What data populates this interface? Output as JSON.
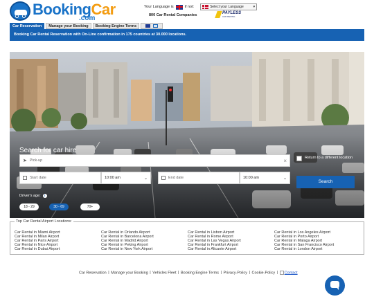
{
  "header": {
    "brand_part1": "Booking",
    "brand_part2": "Car",
    "brand_tld": ".com",
    "language_prompt": "Your Language is",
    "language_if_not": "if not:",
    "language_select": "Select your Language",
    "companies": "800 Car Rental Companies",
    "partner_logo": "PAYLESS",
    "partner_logo_sub": "CAR RENTAL"
  },
  "tabs": [
    {
      "label": "Car Reservation",
      "active": true
    },
    {
      "label": "Manage your Booking",
      "active": false
    },
    {
      "label": "Booking Engine Terms",
      "active": false
    }
  ],
  "banner": "Booking Car Rental Reservation with On-Line confirmation in 175 countries at 30.000 locations.",
  "search": {
    "title": "Search for car hire",
    "pickup_placeholder": "Pick-up",
    "start_date_placeholder": "Start date",
    "start_time": "10:00 am",
    "end_date_placeholder": "End date",
    "end_time": "10:00 am",
    "return_label": "Return to a different location",
    "button": "Search",
    "age_label": "Driver's age:",
    "age_options": [
      "18 - 29",
      "30 - 69",
      "70+"
    ],
    "age_selected": "30 - 69"
  },
  "locations": {
    "legend": "Top Car Rental Airport Locations:",
    "columns": [
      [
        "Car Rental in Miami Airport",
        "Car Rental in Milan Airport",
        "Car Rental in Paris Airport",
        "Car Rental in Nice Airport",
        "Car Rental in Dubai Airport"
      ],
      [
        "Car Rental in Orlando Airport",
        "Car Rental in Barcelona Airport",
        "Car Rental in Madrid Airport",
        "Car Rental in Peking Airport",
        "Car Rental in New York Airport"
      ],
      [
        "Car Rental in Lisbon Airport",
        "Car Rental in Rome Airport",
        "Car Rental in Las Vegas Airport",
        "Car Rental in Frankfurt Airport",
        "Car Rental in Alicante Airport"
      ],
      [
        "Car Rental in Los Angeles Airport",
        "Car Rental in Porto Airport",
        "Car Rental in Malaga Airport",
        "Car Rental in San Francisco Airport",
        "Car Rental in London Airport"
      ]
    ]
  },
  "footer": {
    "links": [
      "Car Reservation",
      "Manage your Booking",
      "Vehicles Fleet",
      "Booking Engine Terms",
      "Privacy-Policy",
      "Cookie-Policy"
    ],
    "contact": "Contact"
  },
  "colors": {
    "brand_blue": "#1762b3",
    "brand_orange": "#f39c12"
  }
}
